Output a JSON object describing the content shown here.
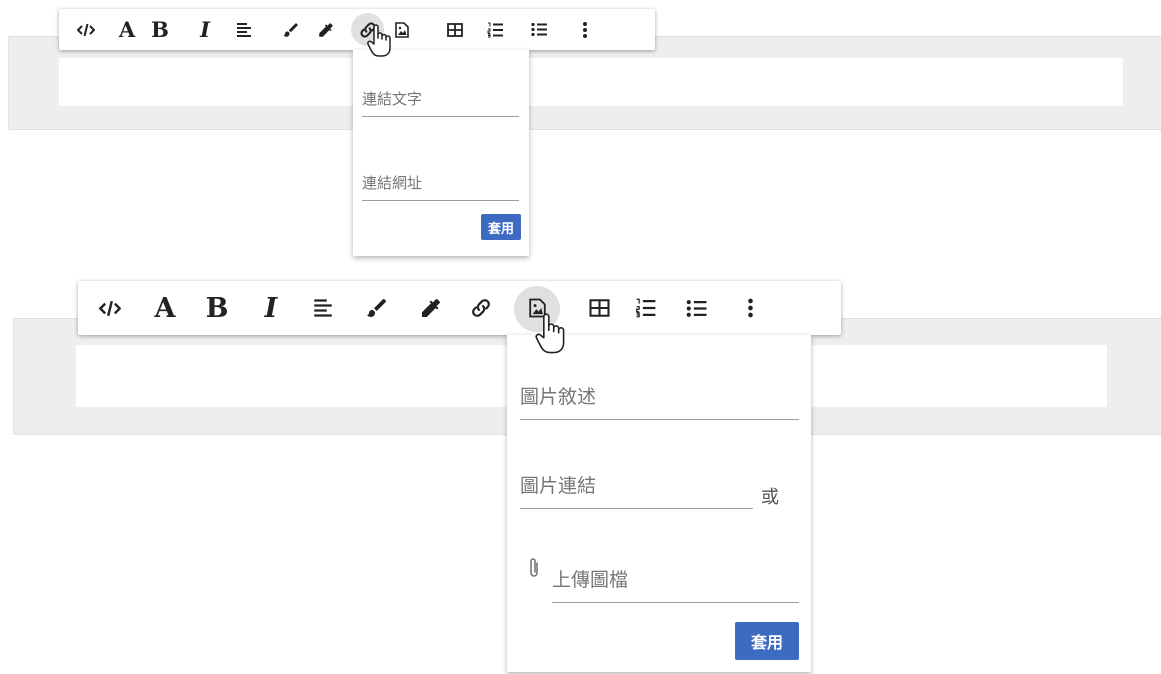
{
  "toolbar_icons": [
    "code-icon",
    "font-icon",
    "bold-icon",
    "italic-icon",
    "align-icon",
    "brush-icon",
    "eyedropper-icon",
    "link-icon",
    "image-icon",
    "table-icon",
    "ordered-list-icon",
    "unordered-list-icon",
    "more-vert-icon"
  ],
  "toolbar_glyphs": {
    "font": "A",
    "bold": "B",
    "italic": "I"
  },
  "link_popup": {
    "text_placeholder": "連結文字",
    "url_placeholder": "連結網址",
    "apply_label": "套用"
  },
  "image_popup": {
    "desc_placeholder": "圖片敘述",
    "url_placeholder": "圖片連結",
    "or_label": "或",
    "upload_placeholder": "上傳圖檔",
    "apply_label": "套用"
  },
  "colors": {
    "accent": "#3c6bc1",
    "editor_bg": "#eeeeee",
    "hover": "#e0e0e0"
  }
}
